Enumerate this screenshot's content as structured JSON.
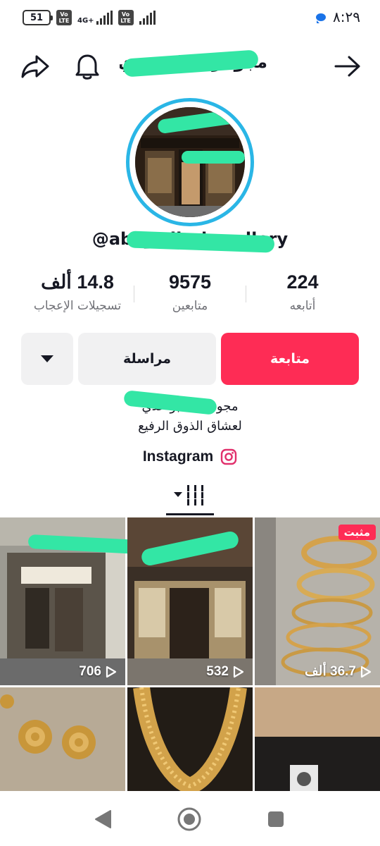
{
  "status_bar": {
    "battery": "51",
    "sim1_badge": "Vo LTE",
    "network": "4G+",
    "sim2_badge": "Vo LTE",
    "time": "٨:٢٩"
  },
  "header": {
    "profile_name": "مجوهرات ابو عدي",
    "icons": [
      "share-icon",
      "bell-icon",
      "back-arrow-icon"
    ]
  },
  "profile": {
    "username": "@abo_adiy_jewellery"
  },
  "stats": {
    "following_value": "224",
    "following_label": "أتابعه",
    "followers_value": "9575",
    "followers_label": "متابعين",
    "likes_value": "14.8 ألف",
    "likes_label": "تسجيلات الإعجاب"
  },
  "actions": {
    "follow_label": "متابعة",
    "message_label": "مراسلة",
    "more_icon": "triangle-down-icon"
  },
  "bio": {
    "line1": "مجوهرات أبو عدي",
    "line2": "لعشاق الذوق الرفيع",
    "link_label": "Instagram"
  },
  "grid": {
    "videos": [
      {
        "views": "706",
        "pinned": ""
      },
      {
        "views": "532",
        "pinned": ""
      },
      {
        "views": "36.7 ألف",
        "pinned": "مثبت"
      },
      {
        "views": "",
        "pinned": ""
      },
      {
        "views": "",
        "pinned": ""
      },
      {
        "views": "",
        "pinned": ""
      }
    ]
  },
  "colors": {
    "accent": "#fe2c55",
    "avatar_ring": "#2ab6e6",
    "redaction": "#33e6a5",
    "instagram": "#e1306c"
  },
  "navbar": {
    "icons": [
      "back-triangle-icon",
      "home-circle-icon",
      "recents-square-icon"
    ]
  }
}
